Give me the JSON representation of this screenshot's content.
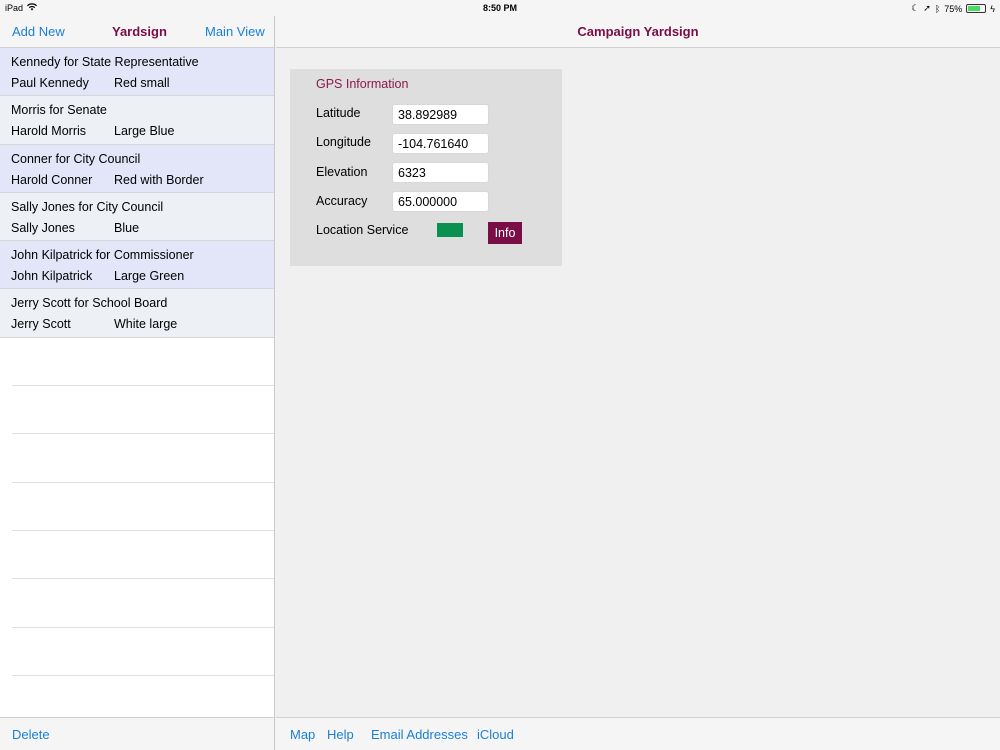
{
  "status": {
    "device": "iPad",
    "time": "8:50 PM",
    "battery": "75%",
    "battery_fill": 0.75
  },
  "master": {
    "add_label": "Add New",
    "title": "Yardsign",
    "main_view_label": "Main View",
    "rows": [
      {
        "title": "Kennedy for State Representative",
        "name": "Paul Kennedy",
        "style": "Red small"
      },
      {
        "title": "Morris for Senate",
        "name": "Harold Morris",
        "style": "Large Blue"
      },
      {
        "title": "Conner for City Council",
        "name": "Harold Conner",
        "style": "Red with Border"
      },
      {
        "title": "Sally Jones for City Council",
        "name": "Sally Jones",
        "style": "Blue"
      },
      {
        "title": "John Kilpatrick for Commissioner",
        "name": "John Kilpatrick",
        "style": "Large Green"
      },
      {
        "title": "Jerry Scott for School Board",
        "name": "Jerry Scott",
        "style": "White large"
      }
    ],
    "delete_label": "Delete"
  },
  "detail": {
    "title": "Campaign Yardsign",
    "gps": {
      "header": "GPS Information",
      "latitude_label": "Latitude",
      "latitude": "38.892989",
      "longitude_label": "Longitude",
      "longitude": "-104.761640",
      "elevation_label": "Elevation",
      "elevation": "6323",
      "accuracy_label": "Accuracy",
      "accuracy": "65.000000",
      "location_label": "Location Service",
      "info_label": "Info"
    },
    "toolbar": {
      "map": "Map",
      "help": "Help",
      "email": "Email Addresses",
      "icloud": "iCloud"
    }
  },
  "colors": {
    "accent": "#7a0d45",
    "link": "#1a7fd6",
    "status_green": "#0a9152"
  }
}
